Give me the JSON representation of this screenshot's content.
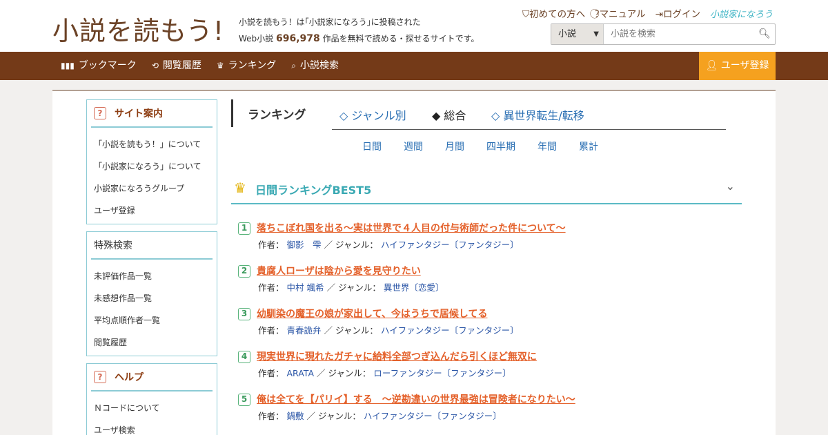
{
  "header": {
    "logo": "小説を読もう!",
    "tagline_line1": "小説を読もう！は｢小説家になろう｣に投稿された",
    "tagline_prefix": "Web小説",
    "work_count": "696,978",
    "tagline_suffix": "作品を無料で読める・探せるサイトです。",
    "links": {
      "first_time": "初めての方へ",
      "manual": "マニュアル",
      "login": "ログイン",
      "narou_logo": "小説家になろう"
    },
    "search": {
      "category": "小説",
      "placeholder": "小説を検索"
    }
  },
  "nav": {
    "bookmark": "ブックマーク",
    "history": "閲覧履歴",
    "ranking": "ランキング",
    "search": "小説検索",
    "register": "ユーザ登録"
  },
  "sidebar": {
    "guide": {
      "title": "サイト案内",
      "items": [
        "「小説を読もう！」について",
        "「小説家になろう」について",
        "小説家になろうグループ",
        "ユーザ登録"
      ]
    },
    "special": {
      "title": "特殊検索",
      "items": [
        "未評価作品一覧",
        "未感想作品一覧",
        "平均点順作者一覧",
        "閲覧履歴"
      ]
    },
    "help": {
      "title": "ヘルプ",
      "items": [
        "Ｎコードについて",
        "ユーザ検索"
      ]
    }
  },
  "main": {
    "ranking_title": "ランキング",
    "tabs": [
      "◇ ジャンル別",
      "◆ 総合",
      "◇ 異世界転生/転移"
    ],
    "periods": [
      "日間",
      "週間",
      "月間",
      "四半期",
      "年間",
      "累計"
    ],
    "section_title": "日間ランキングBEST5",
    "author_label": "作者：",
    "genre_label": "／ ジャンル：",
    "entries": [
      {
        "rank": "1",
        "title": "落ちこぼれ国を出る～実は世界で４人目の付与術師だった件について～",
        "author": "御影　雫",
        "genre": "ハイファンタジー〔ファンタジー〕"
      },
      {
        "rank": "2",
        "title": "貴腐人ローザは陰から愛を見守りたい",
        "author": "中村 颯希",
        "genre": "異世界〔恋愛〕"
      },
      {
        "rank": "3",
        "title": "幼馴染の魔王の娘が家出して、今はうちで居候してる",
        "author": "青春詭弁",
        "genre": "ハイファンタジー〔ファンタジー〕"
      },
      {
        "rank": "4",
        "title": "現実世界に現れたガチャに給料全部つぎ込んだら引くほど無双に",
        "author": "ARATA",
        "genre": "ローファンタジー〔ファンタジー〕"
      },
      {
        "rank": "5",
        "title": "俺は全てを【パリイ】する　～逆勘違いの世界最強は冒険者になりたい～",
        "author": "鍋敷",
        "genre": "ハイファンタジー〔ファンタジー〕"
      }
    ]
  }
}
